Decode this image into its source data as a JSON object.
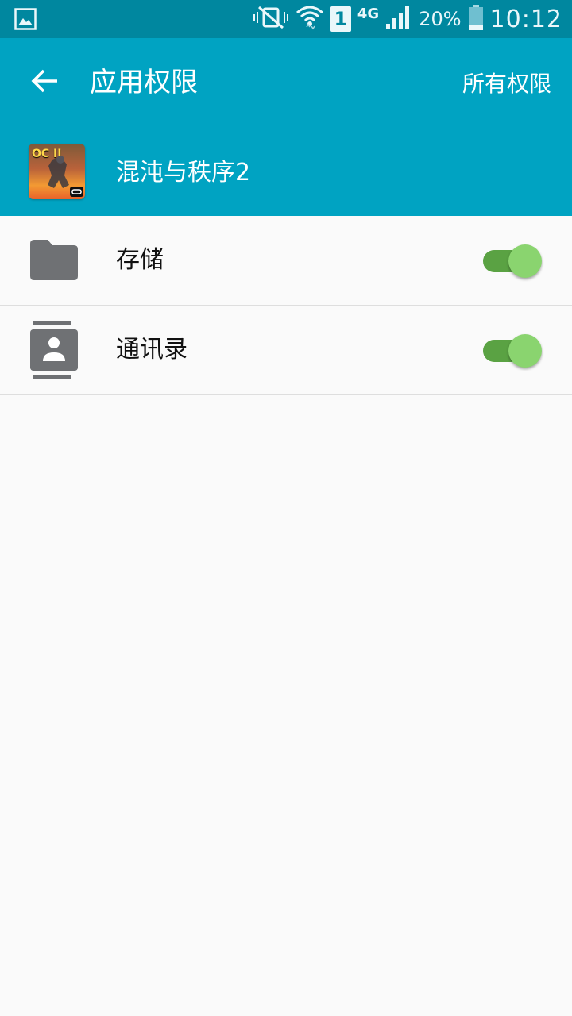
{
  "status_bar": {
    "left_icon": "image-icon",
    "icons": [
      "vibrate-mute-icon",
      "wifi-icon",
      "sim-1-icon",
      "signal-icon",
      "battery-icon"
    ],
    "sim_label": "1",
    "network_type": "4G",
    "battery_percent": "20%",
    "time": "10:12"
  },
  "app_bar": {
    "back_icon": "arrow-left-icon",
    "title": "应用权限",
    "action_label": "所有权限",
    "app_icon_text": "OC II",
    "app_name": "混沌与秩序2"
  },
  "permissions": [
    {
      "label": "存储",
      "icon": "folder-icon",
      "enabled": true
    },
    {
      "label": "通讯录",
      "icon": "contacts-icon",
      "enabled": true
    }
  ],
  "colors": {
    "status_bar": "#00879f",
    "app_bar": "#00a3c2",
    "toggle_track": "#5aa243",
    "toggle_thumb": "#8ad46f",
    "icon_gray": "#6f7174"
  }
}
